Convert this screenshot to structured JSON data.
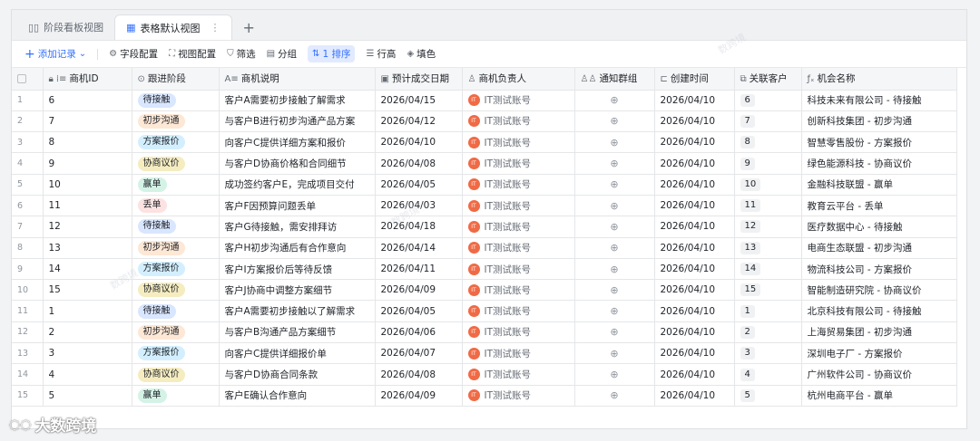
{
  "tabs": [
    {
      "label": "阶段看板视图",
      "icon": "kanban-icon"
    },
    {
      "label": "表格默认视图",
      "icon": "grid-icon",
      "more": "⋮"
    }
  ],
  "toolbar": {
    "add_record": "添加记录",
    "field_config": "字段配置",
    "view_config": "视图配置",
    "filter": "筛选",
    "group": "分组",
    "sort": "1 排序",
    "row_height": "行高",
    "fill_color": "填色"
  },
  "columns": [
    "商机ID",
    "跟进阶段",
    "商机说明",
    "预计成交日期",
    "商机负责人",
    "通知群组",
    "创建时间",
    "关联客户",
    "机会名称"
  ],
  "stage_colors": {
    "待接触": {
      "bg": "#d9e6ff",
      "fg": "#1f2329"
    },
    "初步沟通": {
      "bg": "#fde7d5",
      "fg": "#1f2329"
    },
    "方案报价": {
      "bg": "#d3efff",
      "fg": "#1f2329"
    },
    "协商议价": {
      "bg": "#f5ecc0",
      "fg": "#1f2329"
    },
    "赢单": {
      "bg": "#d4f3e6",
      "fg": "#1f2329"
    },
    "丢单": {
      "bg": "#fde2e2",
      "fg": "#1f2329"
    }
  },
  "rows": [
    {
      "n": "1",
      "id": "6",
      "stage": "待接触",
      "desc": "客户A需要初步接触了解需求",
      "date": "2026/04/15",
      "owner": "IT测试账号",
      "created": "2026/04/10",
      "cust": "6",
      "name": "科技未来有限公司 - 待接触"
    },
    {
      "n": "2",
      "id": "7",
      "stage": "初步沟通",
      "desc": "与客户B进行初步沟通产品方案",
      "date": "2026/04/12",
      "owner": "IT测试账号",
      "created": "2026/04/10",
      "cust": "7",
      "name": "创新科技集团 - 初步沟通"
    },
    {
      "n": "3",
      "id": "8",
      "stage": "方案报价",
      "desc": "向客户C提供详细方案和报价",
      "date": "2026/04/10",
      "owner": "IT测试账号",
      "created": "2026/04/10",
      "cust": "8",
      "name": "智慧零售股份 - 方案报价"
    },
    {
      "n": "4",
      "id": "9",
      "stage": "协商议价",
      "desc": "与客户D协商价格和合同细节",
      "date": "2026/04/08",
      "owner": "IT测试账号",
      "created": "2026/04/10",
      "cust": "9",
      "name": "绿色能源科技 - 协商议价"
    },
    {
      "n": "5",
      "id": "10",
      "stage": "赢单",
      "desc": "成功签约客户E，完成项目交付",
      "date": "2026/04/05",
      "owner": "IT测试账号",
      "created": "2026/04/10",
      "cust": "10",
      "name": "金融科技联盟 - 赢单"
    },
    {
      "n": "6",
      "id": "11",
      "stage": "丢单",
      "desc": "客户F因预算问题丢单",
      "date": "2026/04/03",
      "owner": "IT测试账号",
      "created": "2026/04/10",
      "cust": "11",
      "name": "教育云平台 - 丢单"
    },
    {
      "n": "7",
      "id": "12",
      "stage": "待接触",
      "desc": "客户G待接触，需安排拜访",
      "date": "2026/04/18",
      "owner": "IT测试账号",
      "created": "2026/04/10",
      "cust": "12",
      "name": "医疗数据中心 - 待接触"
    },
    {
      "n": "8",
      "id": "13",
      "stage": "初步沟通",
      "desc": "客户H初步沟通后有合作意向",
      "date": "2026/04/14",
      "owner": "IT测试账号",
      "created": "2026/04/10",
      "cust": "13",
      "name": "电商生态联盟 - 初步沟通"
    },
    {
      "n": "9",
      "id": "14",
      "stage": "方案报价",
      "desc": "客户I方案报价后等待反馈",
      "date": "2026/04/11",
      "owner": "IT测试账号",
      "created": "2026/04/10",
      "cust": "14",
      "name": "物流科技公司 - 方案报价"
    },
    {
      "n": "10",
      "id": "15",
      "stage": "协商议价",
      "desc": "客户J协商中调整方案细节",
      "date": "2026/04/09",
      "owner": "IT测试账号",
      "created": "2026/04/10",
      "cust": "15",
      "name": "智能制造研究院 - 协商议价"
    },
    {
      "n": "11",
      "id": "1",
      "stage": "待接触",
      "desc": "客户A需要初步接触以了解需求",
      "date": "2026/04/05",
      "owner": "IT测试账号",
      "created": "2026/04/10",
      "cust": "1",
      "name": "北京科技有限公司 - 待接触"
    },
    {
      "n": "12",
      "id": "2",
      "stage": "初步沟通",
      "desc": "与客户B沟通产品方案细节",
      "date": "2026/04/06",
      "owner": "IT测试账号",
      "created": "2026/04/10",
      "cust": "2",
      "name": "上海贸易集团 - 初步沟通"
    },
    {
      "n": "13",
      "id": "3",
      "stage": "方案报价",
      "desc": "向客户C提供详细报价单",
      "date": "2026/04/07",
      "owner": "IT测试账号",
      "created": "2026/04/10",
      "cust": "3",
      "name": "深圳电子厂 - 方案报价"
    },
    {
      "n": "14",
      "id": "4",
      "stage": "协商议价",
      "desc": "与客户D协商合同条款",
      "date": "2026/04/08",
      "owner": "IT测试账号",
      "created": "2026/04/10",
      "cust": "4",
      "name": "广州软件公司 - 协商议价"
    },
    {
      "n": "15",
      "id": "5",
      "stage": "赢单",
      "desc": "客户E确认合作意向",
      "date": "2026/04/09",
      "owner": "IT测试账号",
      "created": "2026/04/10",
      "cust": "5",
      "name": "杭州电商平台 - 赢单"
    }
  ],
  "avatar_text": "IT",
  "watermark": "数跨境",
  "brand": "大数跨境"
}
